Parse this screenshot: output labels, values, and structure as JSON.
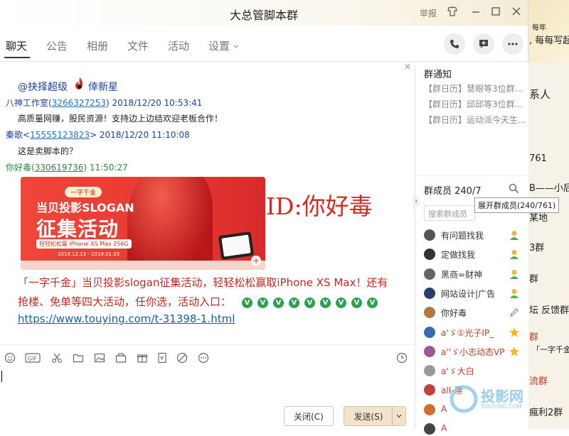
{
  "window": {
    "title": "大总管脚本群",
    "report_label": "举报"
  },
  "tabs": [
    {
      "label": "聊天"
    },
    {
      "label": "公告"
    },
    {
      "label": "相册"
    },
    {
      "label": "文件"
    },
    {
      "label": "活动"
    },
    {
      "label": "设置"
    }
  ],
  "messages": {
    "mention_text": "@抉择超级",
    "mention_name": "倖新星",
    "m1_sender": "八神工作室(",
    "m1_qq": "3266327253",
    "m1_time": ") 2018/12/20 10:53:41",
    "m1_body": "高质量网赚，股民资源！支持边上边结欢迎老板合作！",
    "m2_sender": "秦歌<",
    "m2_qq": "15555123823",
    "m2_time": "> 2018/12/20 11:10:08",
    "m2_body": "这是卖脚本的？",
    "m3_sender": "你好毒(",
    "m3_qq": "330619736",
    "m3_time": ") 11:50:27",
    "id_overlay": "ID:你好毒",
    "poster_tag": "一字千金",
    "poster_line1": "当贝投影SLOGAN",
    "poster_line2": "征集活动",
    "poster_line3": "轻轻松松赢 iPhone XS Max 256G",
    "poster_dates": "2018.12.13 - 2019.01.03",
    "m3_body_line1": "「一字千金」当贝投影slogan征集活动，轻轻松松赢取iPhone XS Max！还有",
    "m3_body_line2": "抢楼、免单等四大活动，任你选，活动入口：",
    "m3_link": "https://www.touying.com/t-31398-1.html",
    "check_glyph": "V"
  },
  "composer": {
    "close_label": "关闭(C)",
    "send_label": "发送(S)"
  },
  "side": {
    "notice_title": "群通知",
    "notices": [
      "【群日历】慧眼等3位群...",
      "【群日历】邱邱等3位群...",
      "【群日历】运动派今天生..."
    ],
    "members_label": "群成员 240/7",
    "search_placeholder": "搜索群成员",
    "tooltip": "展开群成员(240/761)",
    "members": [
      {
        "name": "有问题找我",
        "color": "#333333"
      },
      {
        "name": "定做找我",
        "color": "#333333"
      },
      {
        "name": "黑商=财神",
        "color": "#333333"
      },
      {
        "name": "网站设计|广告",
        "color": "#333333"
      },
      {
        "name": "你好毒",
        "color": "#333333"
      },
      {
        "name": "a'ゞ①光子IP_",
        "color": "#c0392b"
      },
      {
        "name": "a''ゞ小志动态VP",
        "color": "#c0392b"
      },
      {
        "name": "a'ゞ大白",
        "color": "#c0392b"
      },
      {
        "name": "all-漂",
        "color": "#c0392b"
      },
      {
        "name": "A",
        "color": "#c0392b"
      },
      {
        "name": "A",
        "color": "#c0392b"
      }
    ]
  },
  "background": {
    "texts": [
      "每年",
      ", 每每写起",
      "系人",
      "761",
      "B——小后",
      "某地",
      "3群",
      "群",
      "坛 反馈群",
      "群",
      "「一字千金",
      "流群",
      "瘋利2群"
    ]
  },
  "watermark": {
    "text": "投影网",
    "sub": "TOUYING.COM"
  },
  "colors": {
    "accent": "#1a73c2",
    "red": "#c0392b",
    "green": "#2ba24c"
  }
}
